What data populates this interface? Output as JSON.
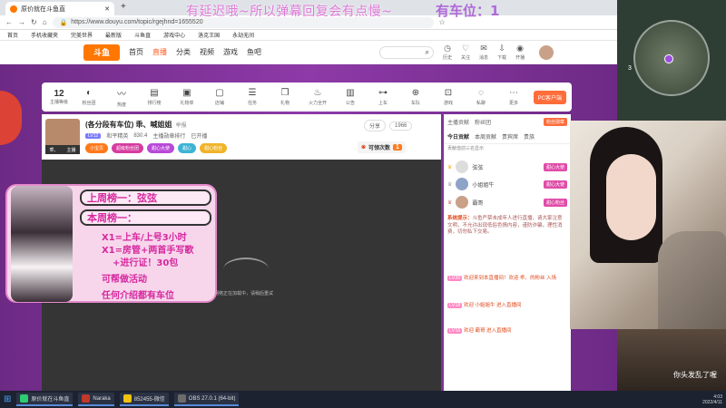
{
  "browser": {
    "tab_title": "原价就在斗鱼直",
    "url": "https://www.douyu.com/topic/rgejhnd=1655520",
    "bookmarks": [
      "首页",
      "手机收藏夹",
      "完美世界",
      "最新版",
      "斗鱼直",
      "游戏中心",
      "洛克王国",
      "永劫无间"
    ]
  },
  "overlay": {
    "line1": "有延迟哦~所以弹幕回复会有点慢~",
    "line2": "有车位：1"
  },
  "site_nav": {
    "logo": "斗鱼",
    "items": [
      "首页",
      "直播",
      "分类",
      "视频",
      "游戏",
      "鱼吧"
    ],
    "active": "直播",
    "icons": [
      {
        "name": "history-icon",
        "label": "历史"
      },
      {
        "name": "follow-icon",
        "label": "关注"
      },
      {
        "name": "message-icon",
        "label": "消息"
      },
      {
        "name": "download-icon",
        "label": "下载"
      },
      {
        "name": "broadcast-icon",
        "label": "开播"
      }
    ]
  },
  "toolbar": {
    "level_num": "12",
    "level_label": "主播等级",
    "tools": [
      {
        "name": "fan-group-icon",
        "label": "粉丝团"
      },
      {
        "name": "heat-icon",
        "label": "热度"
      },
      {
        "name": "rank-icon",
        "label": "排行榜"
      },
      {
        "name": "gift-list-icon",
        "label": "礼物单"
      },
      {
        "name": "shop-icon",
        "label": "店铺"
      },
      {
        "name": "task-icon",
        "label": "任务"
      },
      {
        "name": "gift-icon",
        "label": "礼物"
      },
      {
        "name": "fire-icon",
        "label": "火力全开"
      },
      {
        "name": "doc-icon",
        "label": "公告"
      },
      {
        "name": "car-icon",
        "label": "上车"
      },
      {
        "name": "team-icon",
        "label": "车队"
      },
      {
        "name": "game-icon",
        "label": "游戏"
      },
      {
        "name": "chat-icon",
        "label": "私聊"
      },
      {
        "name": "more-icon",
        "label": "更多"
      }
    ],
    "pc_button": "PC客户端"
  },
  "room": {
    "title": "(各分段有车位) 乖、喊姐姐",
    "title_tag": "举报",
    "anchor_name": "乖、",
    "anchor_sub": "主播",
    "level_tag": "LV12",
    "meta": [
      "和平精英",
      "830.4",
      "主播勋章排行",
      "已开播"
    ],
    "badges": [
      {
        "text": "小宝贝",
        "color": "#ff7a1a"
      },
      {
        "text": "超级粉丝团",
        "color": "#d63ca0"
      },
      {
        "text": "甜心大使",
        "color": "#b84ad8"
      },
      {
        "text": "甜心",
        "color": "#3cb4d6"
      },
      {
        "text": "甜心粉丝",
        "color": "#f0b429"
      }
    ],
    "right_pills": [
      "分享",
      "1966"
    ],
    "collect_label": "可领次数",
    "collect_num": "1"
  },
  "player": {
    "message": "网络正在加载中，请稍后重试"
  },
  "anime_overlay": {
    "box1": "上周榜一：弦弦",
    "box2": "本周榜一：",
    "lines": [
      "X1=上车/上号3小时",
      "X1=房管+两首手写歌",
      "+进行证！30包",
      "可帮做活动",
      "任何介绍都有车位"
    ]
  },
  "chat": {
    "tabs1": [
      "主播贡献",
      "粉丝团"
    ],
    "fan_badge": "粉丝勋章",
    "tabs2": [
      "今日贡献",
      "本周贡献",
      "贵宾席",
      "贵族"
    ],
    "tabs2_active": "今日贡献",
    "rank_header": "贡献值前三名显示",
    "ranks": [
      {
        "name": "弦弦",
        "badge": "甜心大使"
      },
      {
        "name": "小姐姐牛",
        "badge": "甜心大使"
      },
      {
        "name": "霸哥",
        "badge": "甜心粉丝"
      }
    ],
    "system": {
      "prefix": "系统提示：",
      "text": "斗鱼严禁未成年人进行直播，请大家注意文明，不允许出现低俗色情内容，谨防诈骗，理性消费，切勿私下交易。"
    },
    "messages": [
      {
        "tag": "LV20",
        "text": "欢迎来到本直播间！欢迎 乖、的粉丝 入场"
      },
      {
        "tag": "LV18",
        "text": "欢迎 小姐姐牛 进入直播间"
      },
      {
        "tag": "LV16",
        "text": "欢迎 霸哥 进入直播间"
      }
    ]
  },
  "right_panel": {
    "map_number": "3",
    "room_caption": "你头发乱了喔"
  },
  "taskbar": {
    "items": [
      {
        "name": "browser-task",
        "label": "原价就在斗鱼直",
        "color": "#2ecc71"
      },
      {
        "name": "naraka-task",
        "label": "Naraka",
        "color": "#c0392b"
      },
      {
        "name": "app-task",
        "label": "852455-微信",
        "color": "#f1c40f"
      },
      {
        "name": "obs-task",
        "label": "OBS 27.0.1 (64-bit)",
        "color": "#6c6c6c"
      }
    ],
    "time": "4:03",
    "date": "2022/4/11"
  }
}
